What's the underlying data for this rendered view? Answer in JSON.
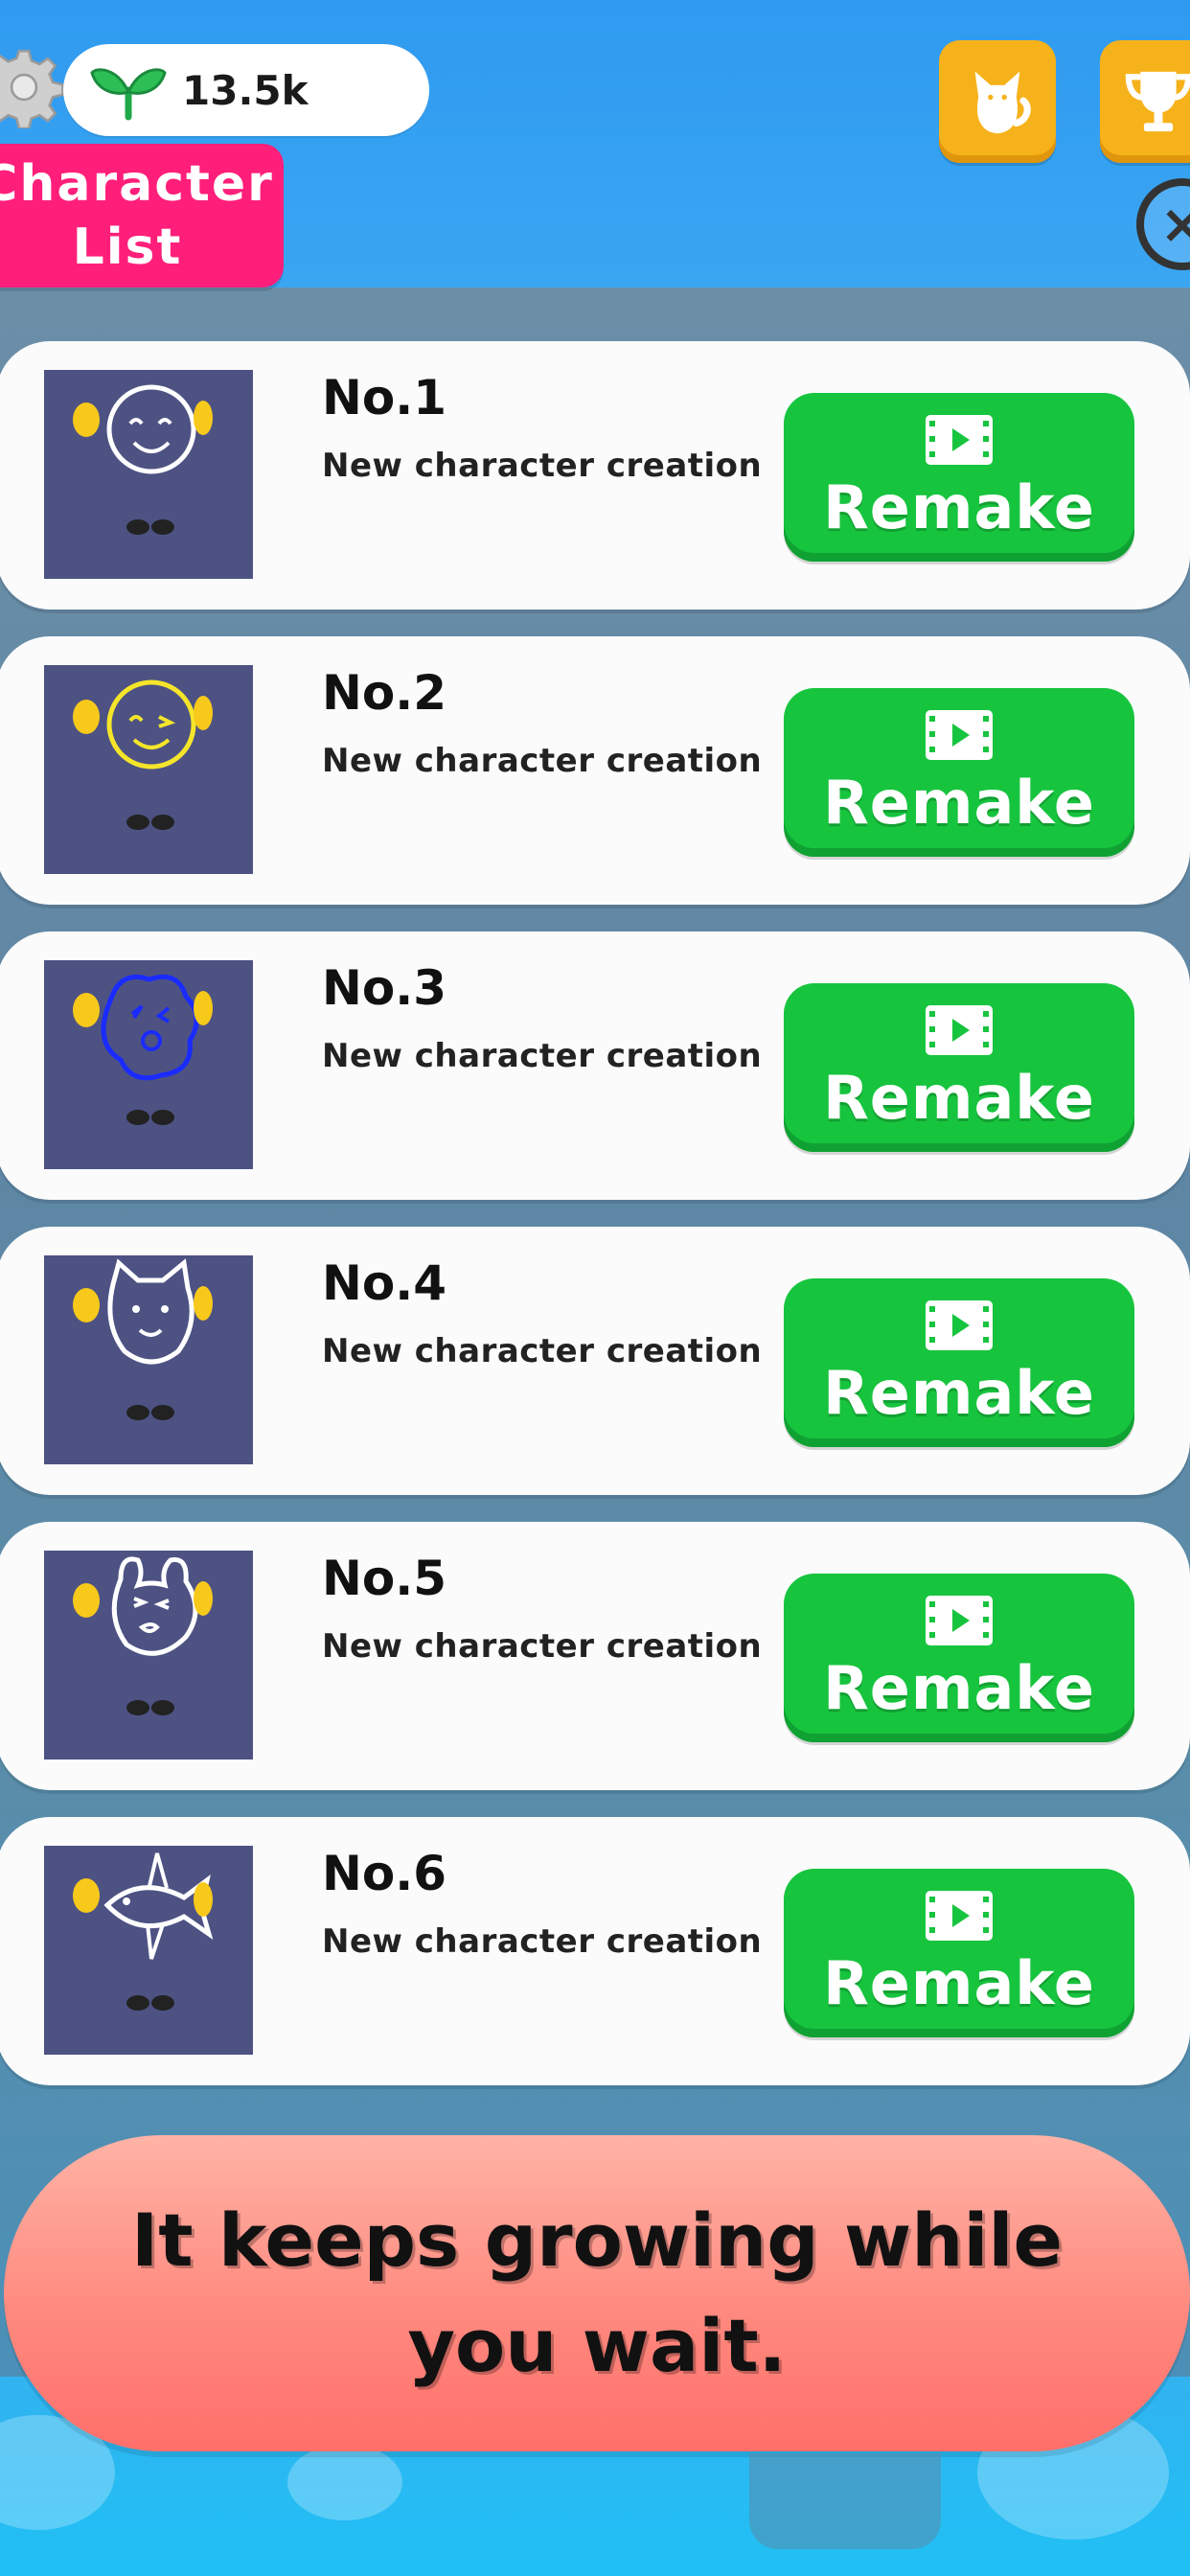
{
  "currency": {
    "amount": "13.5k",
    "icon": "sprout-icon"
  },
  "header": {
    "title": "Character\nList",
    "cat_icon": "cat-icon",
    "trophy_icon": "trophy-icon",
    "close_icon": "close-icon",
    "close_glyph": "×"
  },
  "characters": [
    {
      "number": "No.1",
      "description": "New character creation",
      "button_label": "Remake",
      "drawing": "smiley-face",
      "stroke": "#ffffff"
    },
    {
      "number": "No.2",
      "description": "New character creation",
      "button_label": "Remake",
      "drawing": "winking-face",
      "stroke": "#f5e52a"
    },
    {
      "number": "No.3",
      "description": "New character creation",
      "button_label": "Remake",
      "drawing": "scribble-face",
      "stroke": "#1a2bff"
    },
    {
      "number": "No.4",
      "description": "New character creation",
      "button_label": "Remake",
      "drawing": "cat-face",
      "stroke": "#ffffff"
    },
    {
      "number": "No.5",
      "description": "New character creation",
      "button_label": "Remake",
      "drawing": "bear-face",
      "stroke": "#ffffff"
    },
    {
      "number": "No.6",
      "description": "New character creation",
      "button_label": "Remake",
      "drawing": "fish",
      "stroke": "#ffffff"
    }
  ],
  "banner": {
    "text": "It keeps growing while\nyou wait."
  },
  "colors": {
    "remake_button": "#17c43e",
    "title_tag": "#ff1f7a",
    "top_buttons": "#f6b21a",
    "thumbnail_bg": "#4d5283",
    "banner": "#ff8a7f"
  }
}
